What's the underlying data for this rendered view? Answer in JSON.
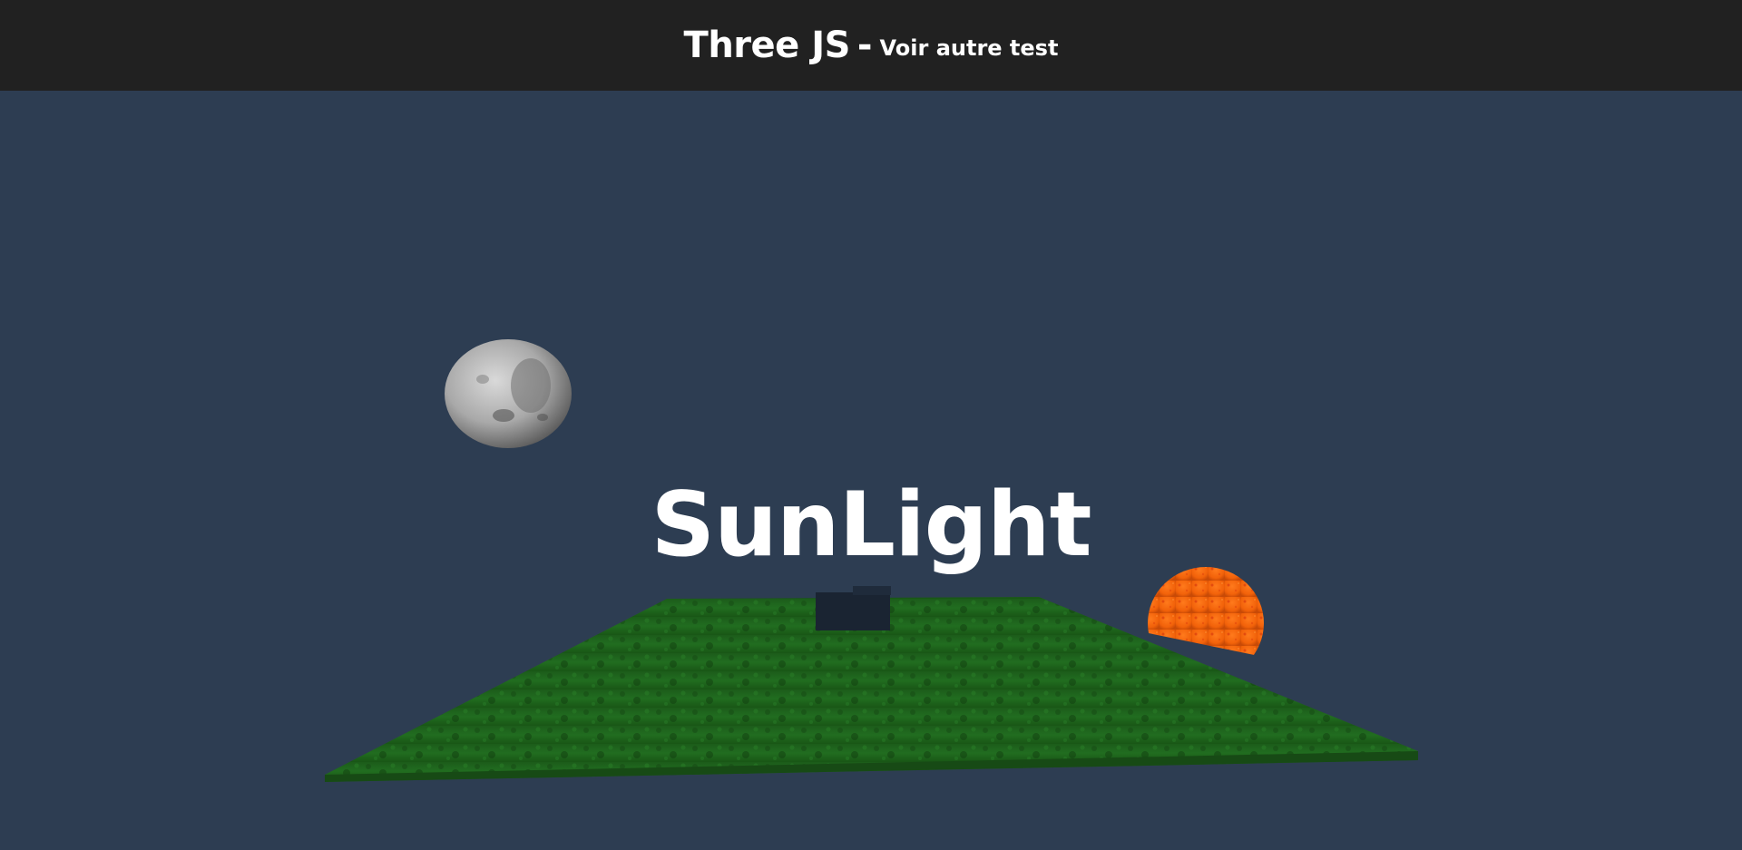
{
  "header": {
    "title": "Three JS",
    "separator": "-",
    "link_label": "Voir autre test"
  },
  "scene": {
    "heading": "SunLight",
    "background_color": "#2d3d52",
    "objects": {
      "moon": {
        "icon": "moon-sphere",
        "color": "#b8b8b8"
      },
      "sun": {
        "icon": "sun-sphere",
        "color": "#ff6a10"
      },
      "ground": {
        "icon": "grass-plane",
        "color": "#1f6a1e"
      },
      "box": {
        "icon": "dark-box",
        "color": "#1a2432"
      }
    }
  },
  "colors": {
    "header_bg": "#212121",
    "text": "#ffffff"
  }
}
